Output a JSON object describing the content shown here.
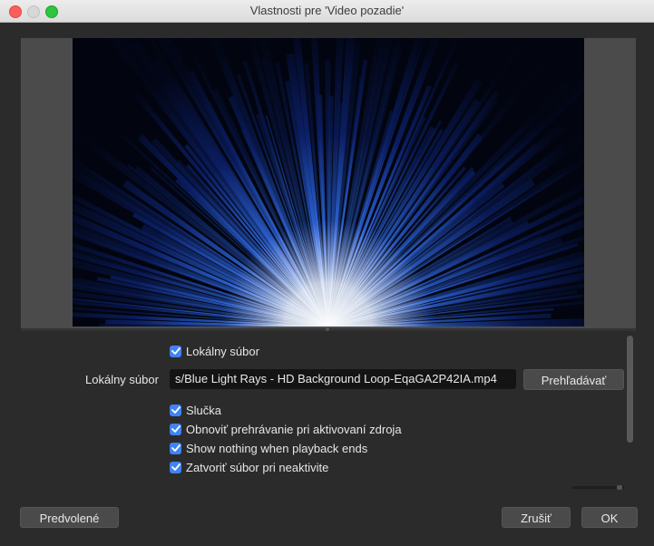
{
  "window": {
    "title": "Vlastnosti pre 'Video pozadie'"
  },
  "source": {
    "local_file_checkbox": {
      "label": "Lokálny súbor",
      "checked": true
    },
    "local_file_field": {
      "label": "Lokálny súbor",
      "value": "s/Blue Light Rays - HD Background Loop-EqaGA2P42IA.mp4"
    },
    "browse_button": "Prehľadávať",
    "options": [
      {
        "label": "Slučka",
        "checked": true
      },
      {
        "label": "Obnoviť prehrávanie pri aktivovaní zdroja",
        "checked": true
      },
      {
        "label": "Show nothing when playback ends",
        "checked": true
      },
      {
        "label": "Zatvoriť súbor pri neaktivite",
        "checked": true
      }
    ]
  },
  "footer": {
    "defaults_button": "Predvolené",
    "cancel_button": "Zrušiť",
    "ok_button": "OK"
  },
  "colors": {
    "accent": "#3f83f6",
    "background": "#2b2b2b"
  }
}
